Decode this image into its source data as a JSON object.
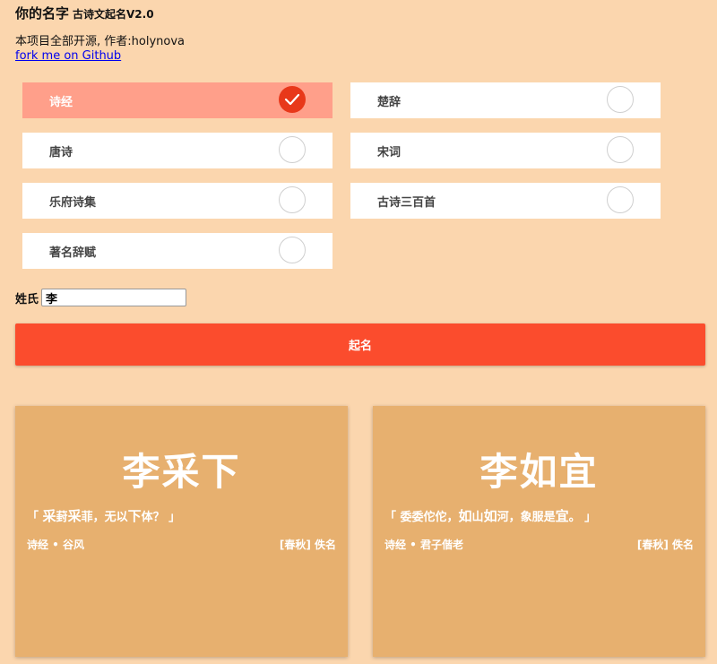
{
  "header": {
    "title": "你的名字",
    "subtitle": "古诗文起名V2.0"
  },
  "intro": {
    "text": "本项目全部开源, 作者:holynova",
    "link": "fork me on Github"
  },
  "sources": [
    {
      "label": "诗经",
      "selected": true
    },
    {
      "label": "楚辞",
      "selected": false
    },
    {
      "label": "唐诗",
      "selected": false
    },
    {
      "label": "宋词",
      "selected": false
    },
    {
      "label": "乐府诗集",
      "selected": false
    },
    {
      "label": "古诗三百首",
      "selected": false
    },
    {
      "label": "著名辞赋",
      "selected": false
    }
  ],
  "surname": {
    "label": "姓氏",
    "value": "李"
  },
  "generate_label": "起名",
  "results": [
    {
      "name": "李采下",
      "verse_parts": [
        "「 ",
        "采",
        "葑",
        "采",
        "菲，无以",
        "下",
        "体？ 」"
      ],
      "book": "诗经 • 谷风",
      "author": "[春秋] 佚名"
    },
    {
      "name": "李如宜",
      "verse_parts": [
        "「 委委佗佗，",
        "如",
        "山",
        "如",
        "河，象服是",
        "宜",
        "。 」"
      ],
      "book": "诗经 • 君子偕老",
      "author": "[春秋] 佚名"
    }
  ],
  "colors": {
    "background": "#fbd6ae",
    "accent": "#fb4c2d",
    "selected_bg": "#ff9f8a",
    "card_bg": "#e7b06f"
  }
}
